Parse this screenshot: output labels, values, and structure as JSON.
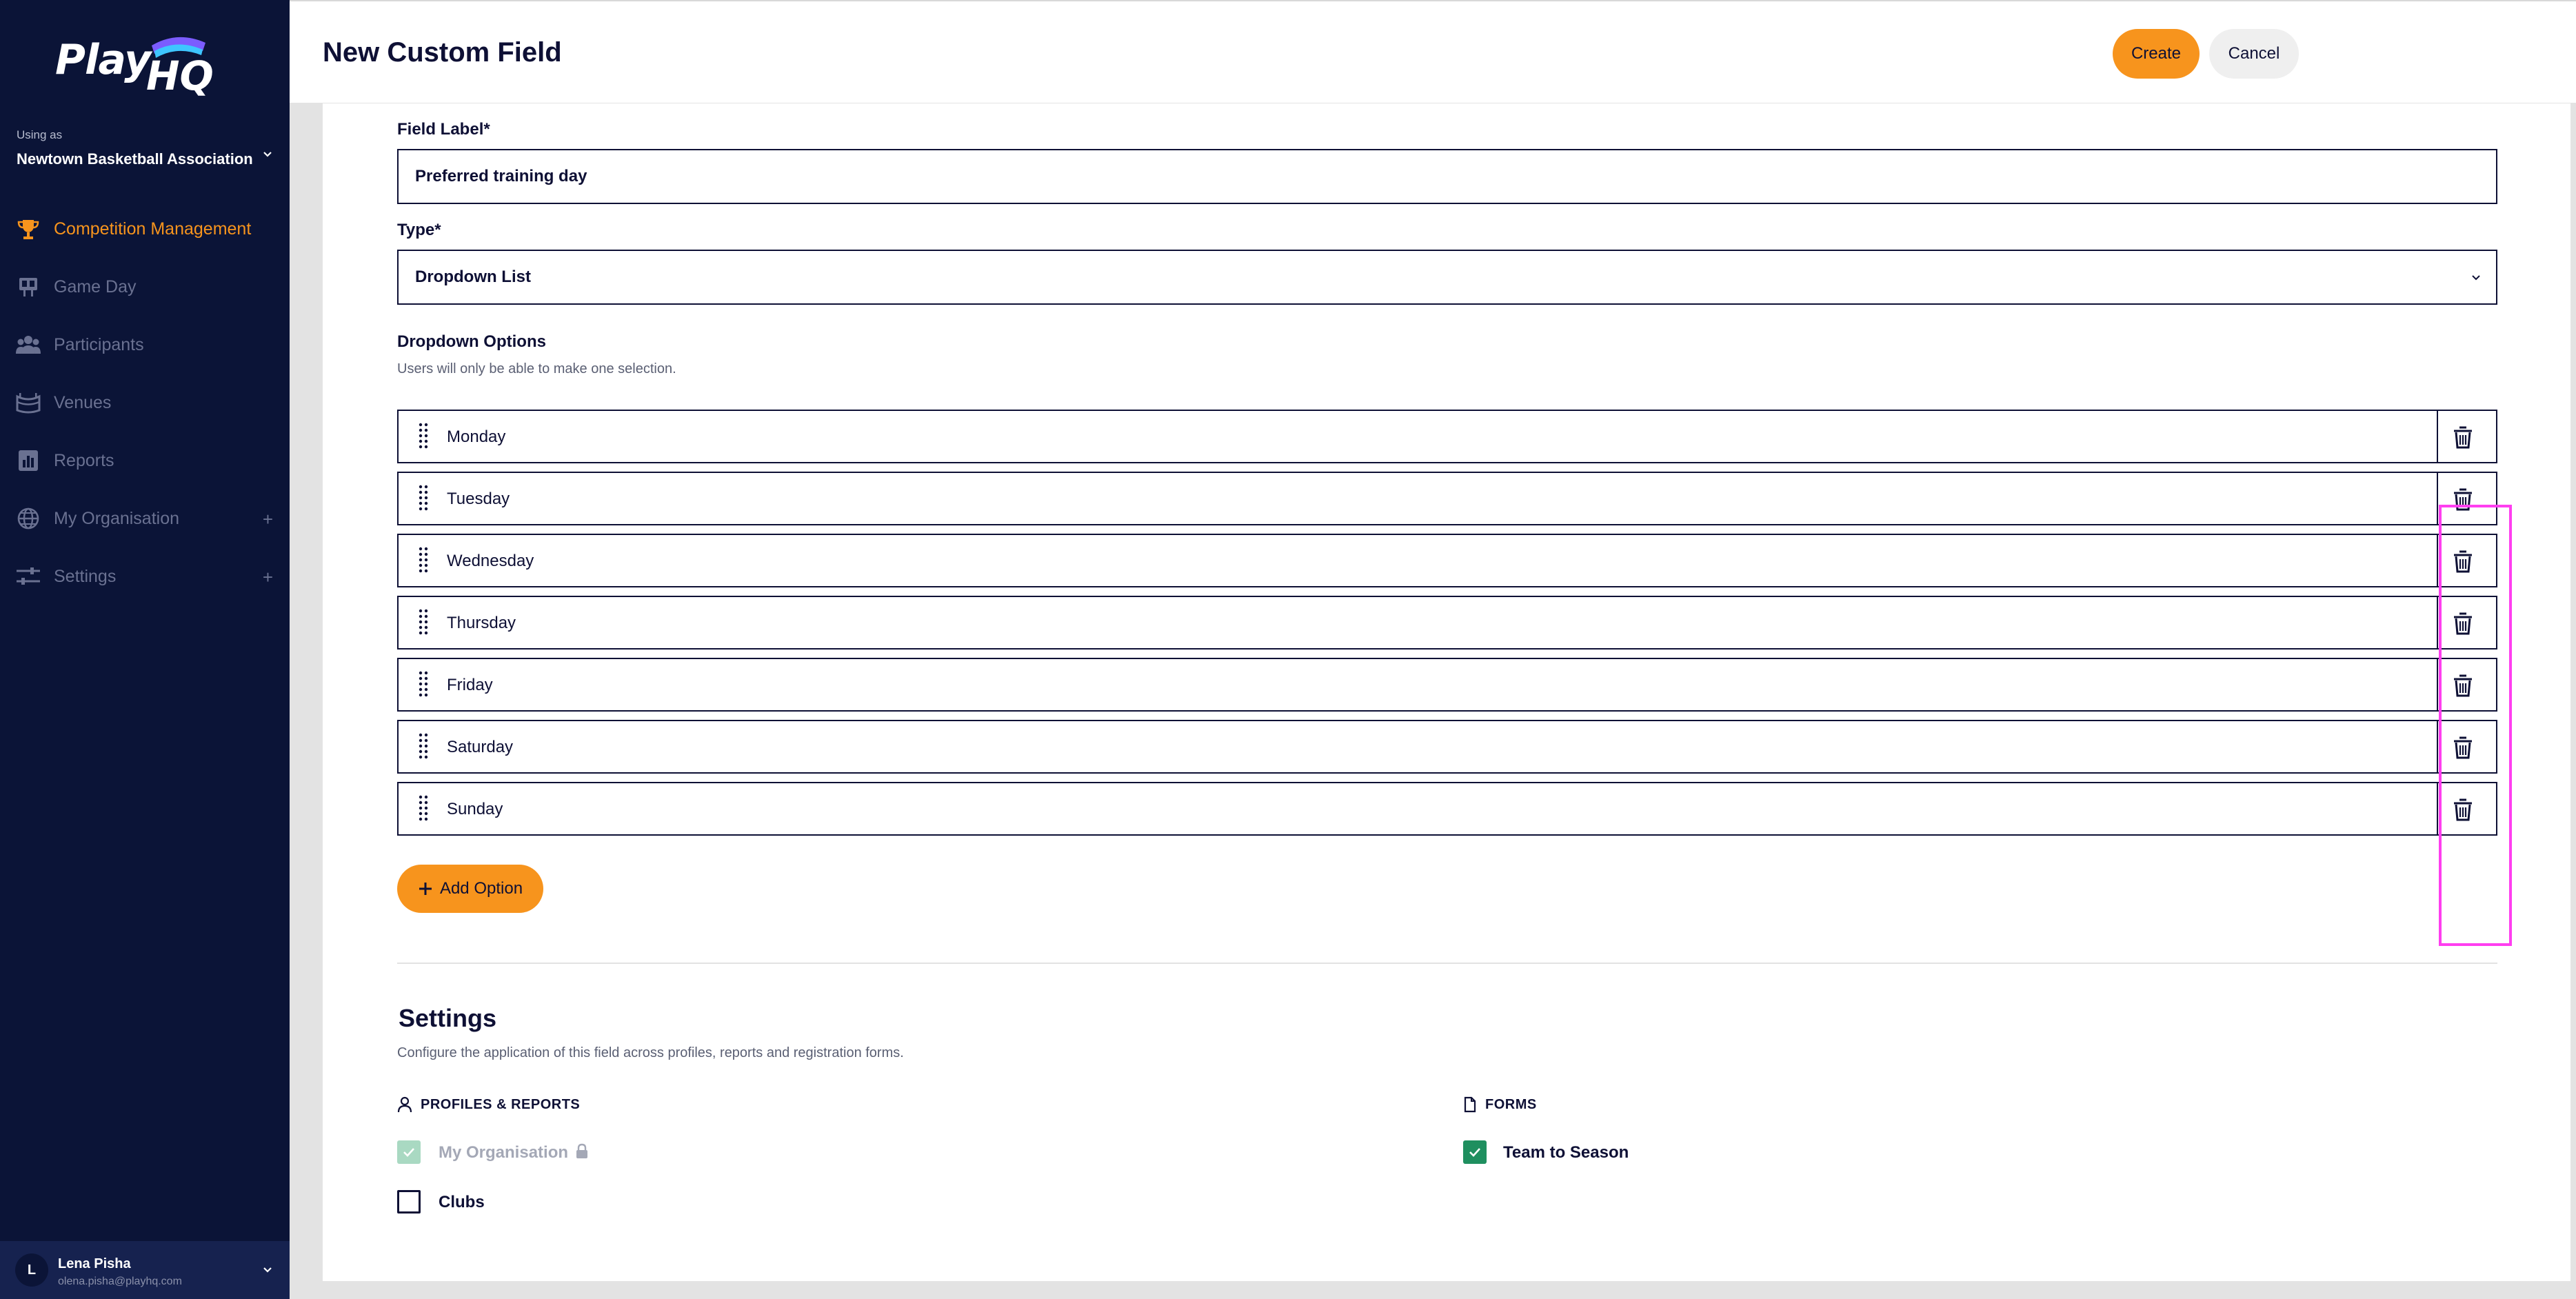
{
  "sidebar": {
    "logo_text": "Play",
    "logo_hq": "HQ",
    "using_as_label": "Using as",
    "organisation": "Newtown Basketball Association",
    "items": [
      {
        "label": "Competition Management",
        "icon": "trophy-icon",
        "active": true
      },
      {
        "label": "Game Day",
        "icon": "scoreboard-icon",
        "active": false
      },
      {
        "label": "Participants",
        "icon": "people-icon",
        "active": false
      },
      {
        "label": "Venues",
        "icon": "stadium-icon",
        "active": false
      },
      {
        "label": "Reports",
        "icon": "report-icon",
        "active": false
      },
      {
        "label": "My Organisation",
        "icon": "globe-icon",
        "active": false,
        "expand": "+"
      },
      {
        "label": "Settings",
        "icon": "sliders-icon",
        "active": false,
        "expand": "+"
      }
    ],
    "user": {
      "initial": "L",
      "name": "Lena Pisha",
      "email": "olena.pisha@playhq.com"
    }
  },
  "header": {
    "title": "New Custom Field",
    "create_label": "Create",
    "cancel_label": "Cancel"
  },
  "form": {
    "field_label_title": "Field Label*",
    "field_label_value": "Preferred training day",
    "type_title": "Type*",
    "type_value": "Dropdown List",
    "dropdown_options_title": "Dropdown Options",
    "dropdown_options_helper": "Users will only be able to make one selection.",
    "options": [
      "Monday",
      "Tuesday",
      "Wednesday",
      "Thursday",
      "Friday",
      "Saturday",
      "Sunday"
    ],
    "add_option_label": "Add Option"
  },
  "settings": {
    "title": "Settings",
    "description": "Configure the application of this field across profiles, reports and registration forms.",
    "profiles_heading": "PROFILES & REPORTS",
    "forms_heading": "FORMS",
    "my_org_label": "My Organisation",
    "clubs_label": "Clubs",
    "team_to_season_label": "Team to Season",
    "my_org_checked": true,
    "clubs_checked": false,
    "team_to_season_checked": true
  },
  "colors": {
    "sidebar_bg": "#0b1437",
    "accent": "#f7941d",
    "check_green": "#1f8f5f",
    "highlight": "#ff3ef0"
  }
}
